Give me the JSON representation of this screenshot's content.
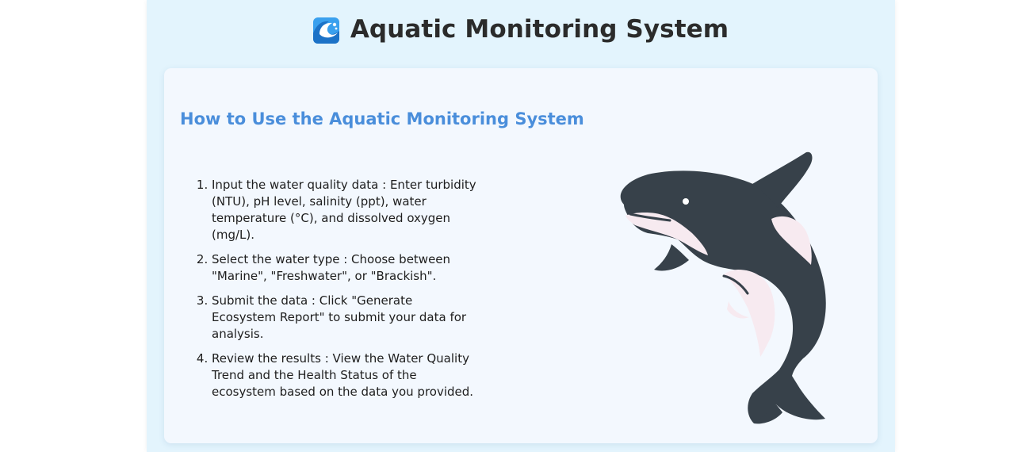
{
  "header": {
    "title": "Aquatic Monitoring System",
    "logo_icon": "wave-icon"
  },
  "instructions": {
    "heading": "How to Use the Aquatic Monitoring System",
    "steps": [
      {
        "text": "Input the water quality data : Enter turbidity (NTU), pH level, salinity (ppt), water temperature (°C), and dissolved oxygen (mg/L)."
      },
      {
        "text": "Select the water type : Choose between \"Marine\", \"Freshwater\", or \"Brackish\"."
      },
      {
        "text": "Submit the data : Click \"Generate Ecosystem Report\" to submit your data for analysis."
      },
      {
        "text": "Review the results : View the Water Quality Trend and the Health Status of the ecosystem based on the data you provided."
      }
    ],
    "illustration": "orca-icon"
  },
  "colors": {
    "page_bg": "#e3f4fd",
    "card_bg": "#f3f8fe",
    "heading_blue": "#4a8edb",
    "orca_dark": "#37414a",
    "orca_light": "#f7eaf0"
  }
}
